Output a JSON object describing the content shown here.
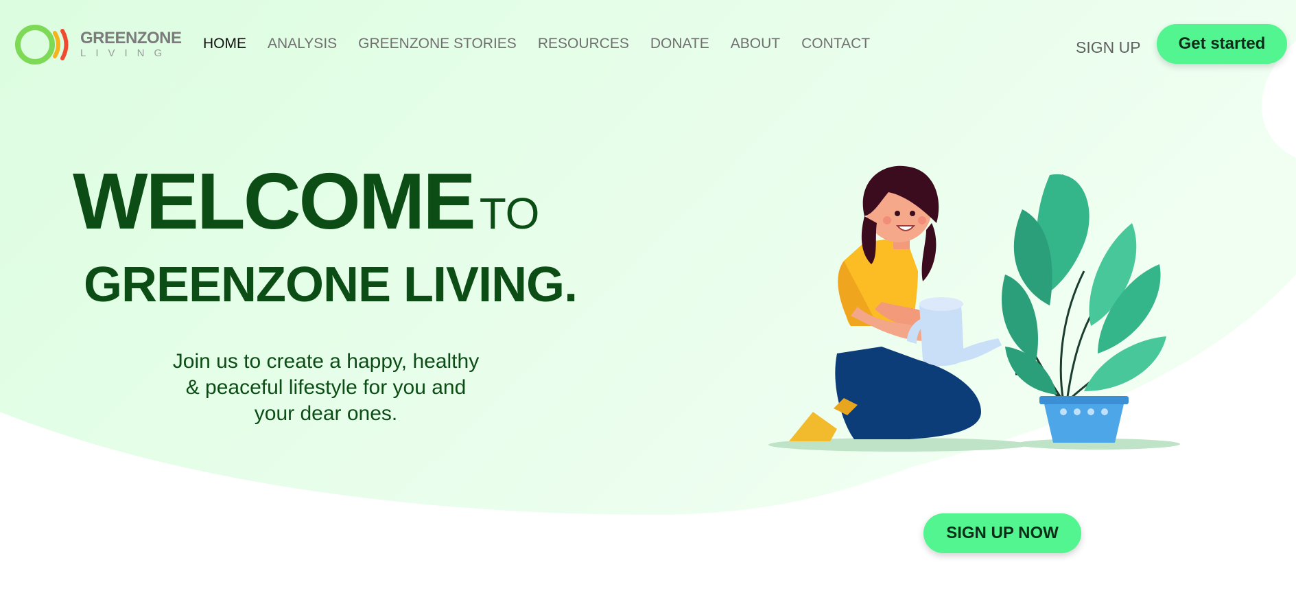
{
  "logo": {
    "name": "GREENZONE",
    "sub": "LIVING"
  },
  "nav": {
    "items": [
      {
        "label": "HOME",
        "active": true
      },
      {
        "label": "ANALYSIS"
      },
      {
        "label": "GREENZONE STORIES"
      },
      {
        "label": "RESOURCES"
      },
      {
        "label": "DONATE"
      },
      {
        "label": "ABOUT"
      },
      {
        "label": "CONTACT"
      }
    ],
    "sign_up_label": "SIGN UP",
    "get_started_label": "Get started"
  },
  "hero": {
    "welcome": "WELCOME",
    "to": "TO",
    "title": "GREENZONE LIVING.",
    "subtitle_lines": [
      "Join us to create a happy, healthy",
      "& peaceful lifestyle for you and",
      "your dear ones."
    ]
  },
  "cta": {
    "sign_up_now_label": "SIGN UP NOW"
  },
  "colors": {
    "accent": "#52f590",
    "hero_text": "#0b4d14",
    "background_tint": "#e2fde6"
  },
  "icons": {
    "logo": "ring-signal-icon",
    "illustration": "woman-watering-plant-illustration"
  }
}
